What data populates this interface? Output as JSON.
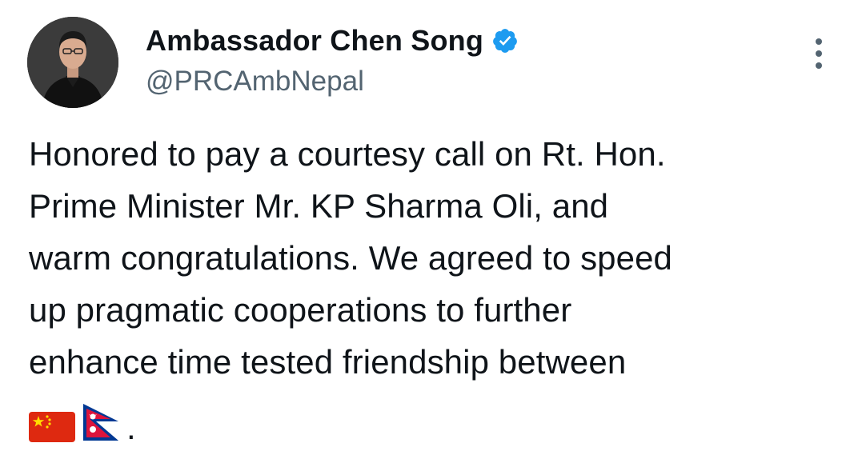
{
  "tweet": {
    "display_name": "Ambassador Chen Song",
    "handle": "@PRCAmbNepal",
    "verified": true,
    "text_lines": [
      "Honored to pay a courtesy call on Rt. Hon.",
      "Prime Minister Mr. KP Sharma Oli, and",
      "warm congratulations. We agreed to speed",
      "up pragmatic cooperations to further",
      "enhance time tested friendship between"
    ],
    "trailing_emojis": [
      "flag-china",
      "flag-nepal"
    ],
    "trailing_text": "."
  },
  "icons": {
    "verified": "verified-badge-icon",
    "more": "more-options-icon"
  },
  "colors": {
    "text": "#0f1419",
    "secondary_text": "#536471",
    "verified_blue": "#1d9bf0",
    "china_red": "#de2910",
    "china_yellow": "#ffde00",
    "nepal_crimson": "#dc143c",
    "nepal_blue": "#003893"
  }
}
